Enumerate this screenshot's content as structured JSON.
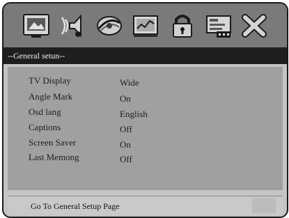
{
  "toolbar": {
    "icons": [
      {
        "name": "tv-display-icon"
      },
      {
        "name": "audio-setup-icon"
      },
      {
        "name": "dolby-digital-icon"
      },
      {
        "name": "video-setup-icon"
      },
      {
        "name": "password-lock-icon"
      },
      {
        "name": "preference-icon"
      },
      {
        "name": "exit-icon"
      }
    ]
  },
  "section": {
    "title": "--General setun--"
  },
  "menu": {
    "items": [
      {
        "label": "TV Display",
        "value": "Wide"
      },
      {
        "label": "Angle Mark",
        "value": "On"
      },
      {
        "label": "Osd lang",
        "value": "English"
      },
      {
        "label": "Captions",
        "value": "Off"
      },
      {
        "label": "Screen Saver",
        "value": "On"
      },
      {
        "label": "Last Memong",
        "value": "Off"
      }
    ]
  },
  "status": {
    "text": "Go To General Setup Page"
  }
}
